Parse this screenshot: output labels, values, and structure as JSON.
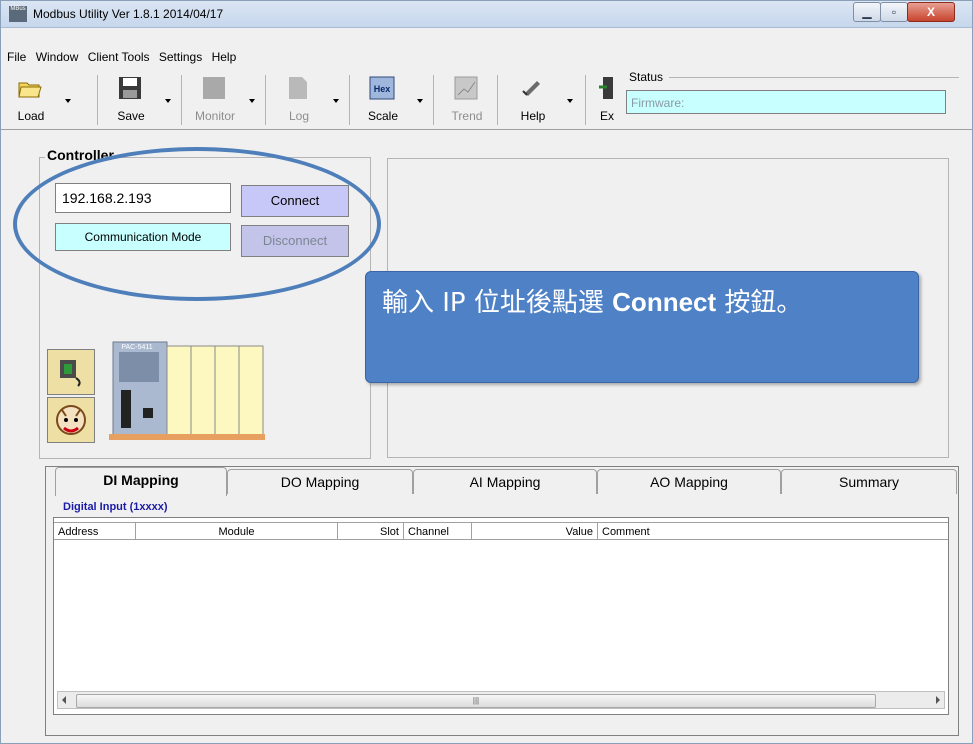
{
  "window": {
    "title": "Modbus Utility   Ver 1.8.1    2014/04/17",
    "app_icon_text": "MBus"
  },
  "menu": [
    "File",
    "Window",
    "Client Tools",
    "Settings",
    "Help"
  ],
  "toolbar": {
    "buttons": [
      {
        "label": "Load",
        "icon": "folder-open-icon",
        "enabled": true
      },
      {
        "label": "Save",
        "icon": "floppy-disk-icon",
        "enabled": true
      },
      {
        "label": "Monitor",
        "icon": "monitor-icon",
        "enabled": false
      },
      {
        "label": "Log",
        "icon": "document-icon",
        "enabled": false
      },
      {
        "label": "Scale",
        "icon": "hex-icon",
        "icon_text": "Hex",
        "enabled": true
      },
      {
        "label": "Trend",
        "icon": "trend-chart-icon",
        "enabled": false
      },
      {
        "label": "Help",
        "icon": "help-phone-icon",
        "enabled": true
      },
      {
        "label": "Ex",
        "icon": "exit-icon",
        "enabled": true
      }
    ]
  },
  "status": {
    "label": "Status",
    "firmware_placeholder": "Firmware:"
  },
  "controller": {
    "title": "Controller",
    "ip_value": "192.168.2.193",
    "connect_label": "Connect",
    "disconnect_label": "Disconnect",
    "comm_mode_label": "Communication Mode",
    "device_label": "PAC-5411"
  },
  "callout": {
    "text_pre": "輸入 IP 位址後點選 ",
    "text_bold": "Connect",
    "text_post": " 按鈕。"
  },
  "tabs": [
    {
      "label": "DI Mapping",
      "active": true
    },
    {
      "label": "DO Mapping",
      "active": false
    },
    {
      "label": "AI Mapping",
      "active": false
    },
    {
      "label": "AO Mapping",
      "active": false
    },
    {
      "label": "Summary",
      "active": false
    }
  ],
  "di_panel": {
    "title": "Digital Input  (1xxxx)",
    "columns": [
      "Address",
      "Module",
      "Slot",
      "Channel",
      "Value",
      "Comment"
    ],
    "rows": []
  },
  "colors": {
    "accent": "#4f81c6",
    "cyan_field": "#c8ffff",
    "button_lavender": "#c8c8f8"
  }
}
